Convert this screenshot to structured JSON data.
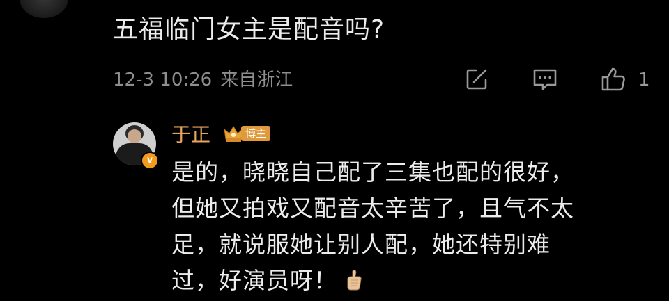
{
  "comment": {
    "text": "五福临门女主是配音吗?",
    "date": "12-3 10:26",
    "location": "来自浙江",
    "like_count": "1",
    "icons": [
      "share-icon",
      "reply-icon",
      "like-icon"
    ]
  },
  "reply": {
    "username": "于正",
    "tag": "博主",
    "lines": [
      "是的，晓晓自己配了三集也配的很好，",
      "但她又拍戏又配音太辛苦了，且气不太",
      "足，就说服她让别人配，她还特别难",
      "过，好演员呀！"
    ],
    "emoji": "thumbs-up-emoji",
    "badge": "v"
  },
  "colors": {
    "background": "#000000",
    "text": "#ececec",
    "meta": "#8e8e8e",
    "username": "#e8a35c",
    "tag": "#e09a3c",
    "verified": "#f29a1e"
  }
}
